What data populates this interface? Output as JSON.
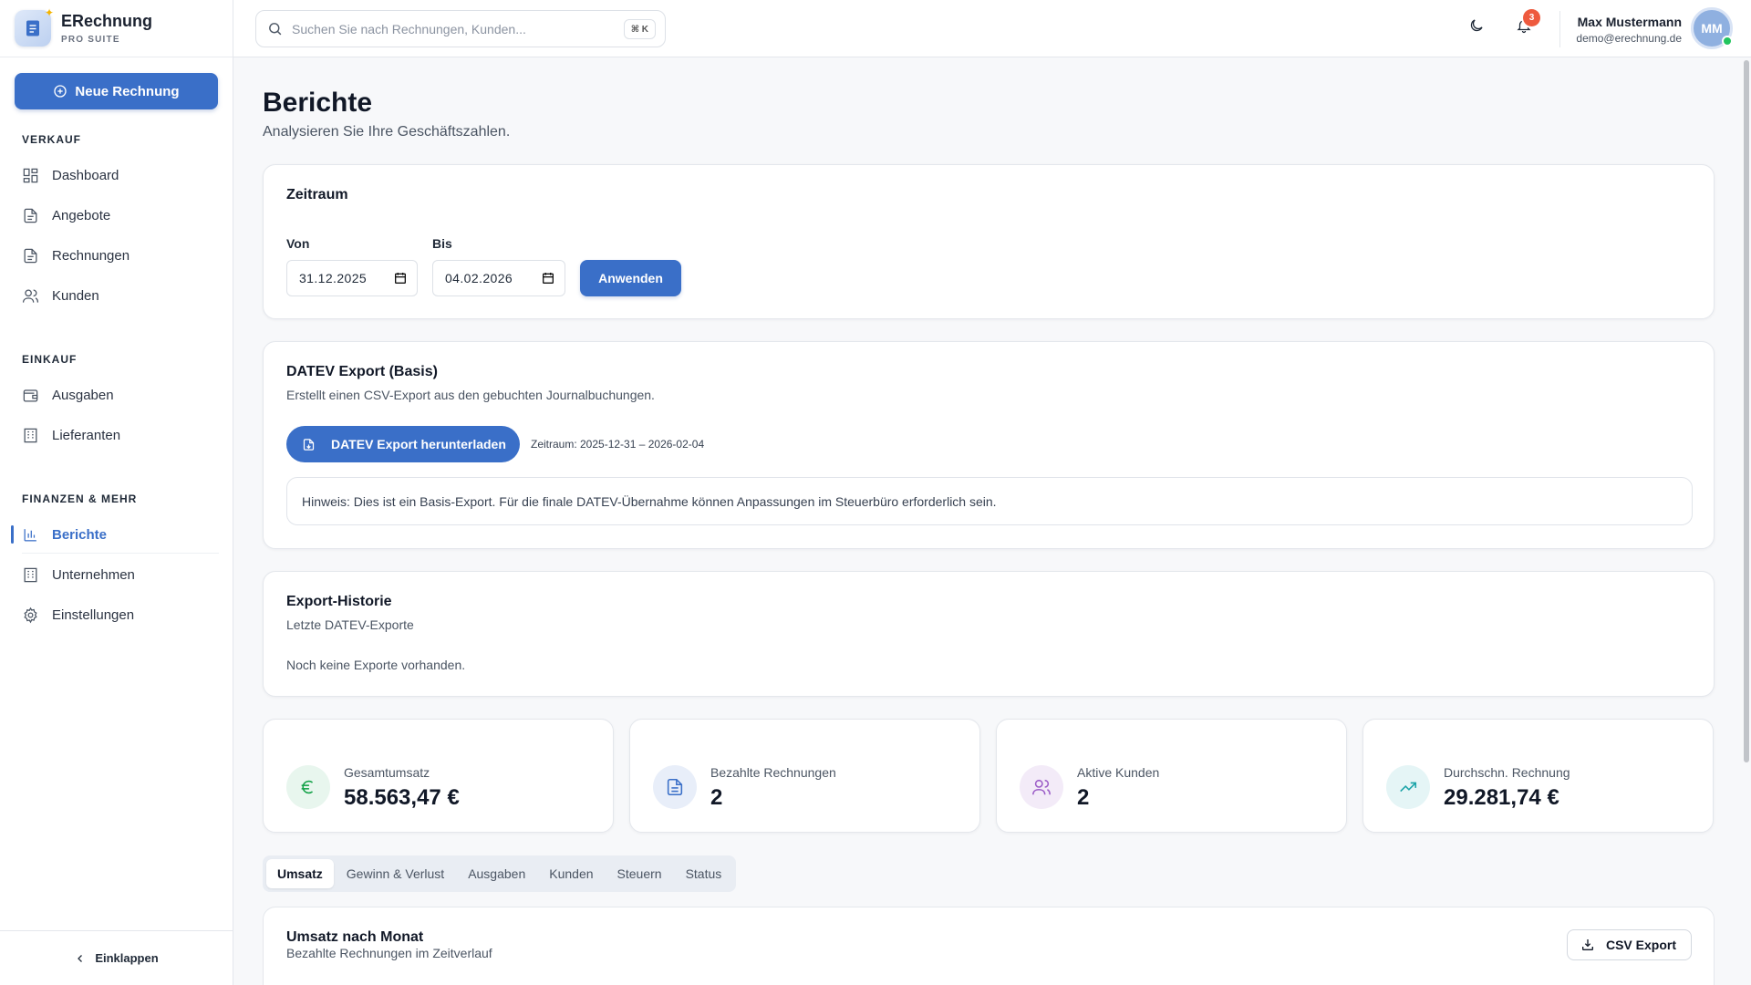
{
  "brand": {
    "name": "ERechnung",
    "sub": "PRO SUITE"
  },
  "sidebar": {
    "new_button": "Neue Rechnung",
    "sections": [
      {
        "title": "VERKAUF",
        "items": [
          "Dashboard",
          "Angebote",
          "Rechnungen",
          "Kunden"
        ]
      },
      {
        "title": "EINKAUF",
        "items": [
          "Ausgaben",
          "Lieferanten"
        ]
      },
      {
        "title": "FINANZEN & MEHR",
        "items": [
          "Berichte",
          "Unternehmen",
          "Einstellungen"
        ]
      }
    ],
    "active_item": "Berichte",
    "collapse_label": "Einklappen"
  },
  "topbar": {
    "search_placeholder": "Suchen Sie nach Rechnungen, Kunden...",
    "shortcut": "⌘ K",
    "notification_count": "3",
    "user_name": "Max Mustermann",
    "user_email": "demo@erechnung.de",
    "avatar_initials": "MM"
  },
  "page": {
    "title": "Berichte",
    "subtitle": "Analysieren Sie Ihre Geschäftszahlen."
  },
  "zeitraum": {
    "title": "Zeitraum",
    "from_label": "Von",
    "from_value": "31.12.2025",
    "to_label": "Bis",
    "to_value": "04.02.2026",
    "apply_label": "Anwenden"
  },
  "datev": {
    "title": "DATEV Export (Basis)",
    "subtitle": "Erstellt einen CSV-Export aus den gebuchten Journalbuchungen.",
    "button": "DATEV Export herunterladen",
    "range": "Zeitraum: 2025-12-31 – 2026-02-04",
    "hint": "Hinweis: Dies ist ein Basis-Export. Für die finale DATEV-Übernahme können Anpassungen im Steuerbüro erforderlich sein."
  },
  "history": {
    "title": "Export-Historie",
    "subtitle": "Letzte DATEV-Exporte",
    "empty": "Noch keine Exporte vorhanden."
  },
  "stats": [
    {
      "label": "Gesamtumsatz",
      "value": "58.563,47 €",
      "icon": "euro-icon",
      "color": "#16a34a",
      "bg": "#e8f6ee"
    },
    {
      "label": "Bezahlte Rechnungen",
      "value": "2",
      "icon": "document-icon",
      "color": "#3a6fc8",
      "bg": "#e8eef9"
    },
    {
      "label": "Aktive Kunden",
      "value": "2",
      "icon": "users-icon",
      "color": "#9b5cc7",
      "bg": "#f3ebf8"
    },
    {
      "label": "Durchschn. Rechnung",
      "value": "29.281,74 €",
      "icon": "trending-up-icon",
      "color": "#1aa3a8",
      "bg": "#e5f5f6"
    }
  ],
  "tabs": [
    "Umsatz",
    "Gewinn & Verlust",
    "Ausgaben",
    "Kunden",
    "Steuern",
    "Status"
  ],
  "active_tab": "Umsatz",
  "chart_section": {
    "title": "Umsatz nach Monat",
    "subtitle": "Bezahlte Rechnungen im Zeitverlauf",
    "csv_button": "CSV Export"
  },
  "colors": {
    "accent": "#3a6fc8",
    "badge": "#ee5a3e",
    "online": "#22c55e"
  }
}
